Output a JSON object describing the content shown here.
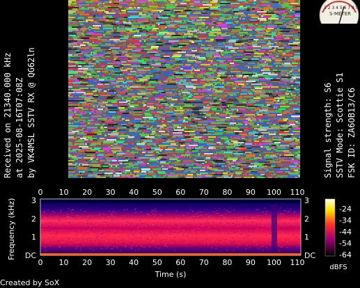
{
  "left_caption": {
    "line1": "Received on  21340.000 kHz",
    "line2": "at 2025-08-16T07:08Z",
    "line3": "by VK4MSL SSTV RX @ QG62ln"
  },
  "right_caption": {
    "line1": "Signal strength: S6",
    "line2": "SSTV Mode: Scottie S1",
    "line3": "FSK ID: ZA6OB13/C6"
  },
  "smeter": {
    "scale_text": "1 2 3 4 5 6 7 8 9",
    "label": "S-METER",
    "value": 6
  },
  "spectrogram": {
    "ylabel": "Frequency (kHz)",
    "xlabel": "Time (s)",
    "x_ticks": [
      "0",
      "10",
      "20",
      "30",
      "40",
      "50",
      "60",
      "70",
      "80",
      "90",
      "100",
      "110"
    ],
    "y_ticks": [
      "DC",
      "1",
      "2",
      "3"
    ],
    "colorbar_ticks": [
      "-24",
      "-34",
      "-44",
      "-54",
      "-64"
    ],
    "colorbar_unit": "dBFS"
  },
  "footer": "Created by SoX",
  "colors": {
    "background": "#000000",
    "spectro_low": "#120060",
    "spectro_mid": "#b0005a",
    "spectro_high": "#ff2a4e"
  }
}
